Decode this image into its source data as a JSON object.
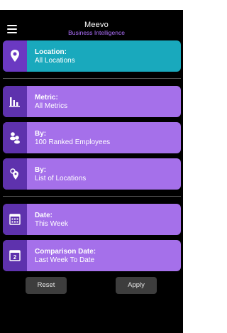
{
  "header": {
    "brand_name": "Meevo",
    "brand_tagline": "Business Intelligence"
  },
  "filters": [
    {
      "title": "Location:",
      "value": "All Locations",
      "icon": "location-pin-icon",
      "color": "#19a9bd"
    },
    {
      "title": "Metric:",
      "value": "All Metrics",
      "icon": "bar-chart-icon",
      "color": "#a570ea"
    },
    {
      "title": "By:",
      "value": "100 Ranked Employees",
      "icon": "people-icon",
      "color": "#a570ea"
    },
    {
      "title": "By:",
      "value": "List of Locations",
      "icon": "locations-icon",
      "color": "#a570ea"
    },
    {
      "title": "Date:",
      "value": "This Week",
      "icon": "calendar-icon",
      "color": "#a570ea"
    },
    {
      "title": "Comparison Date:",
      "value": "Last Week To Date",
      "icon": "calendar-2-icon",
      "calendar_day": "2",
      "color": "#a570ea"
    }
  ],
  "actions": {
    "reset_label": "Reset",
    "apply_label": "Apply"
  },
  "colors": {
    "background": "#000000",
    "accent_teal": "#19a9bd",
    "accent_purple": "#a570ea",
    "icon_box": "#5e32ad",
    "brand_tagline": "#b070ff"
  }
}
